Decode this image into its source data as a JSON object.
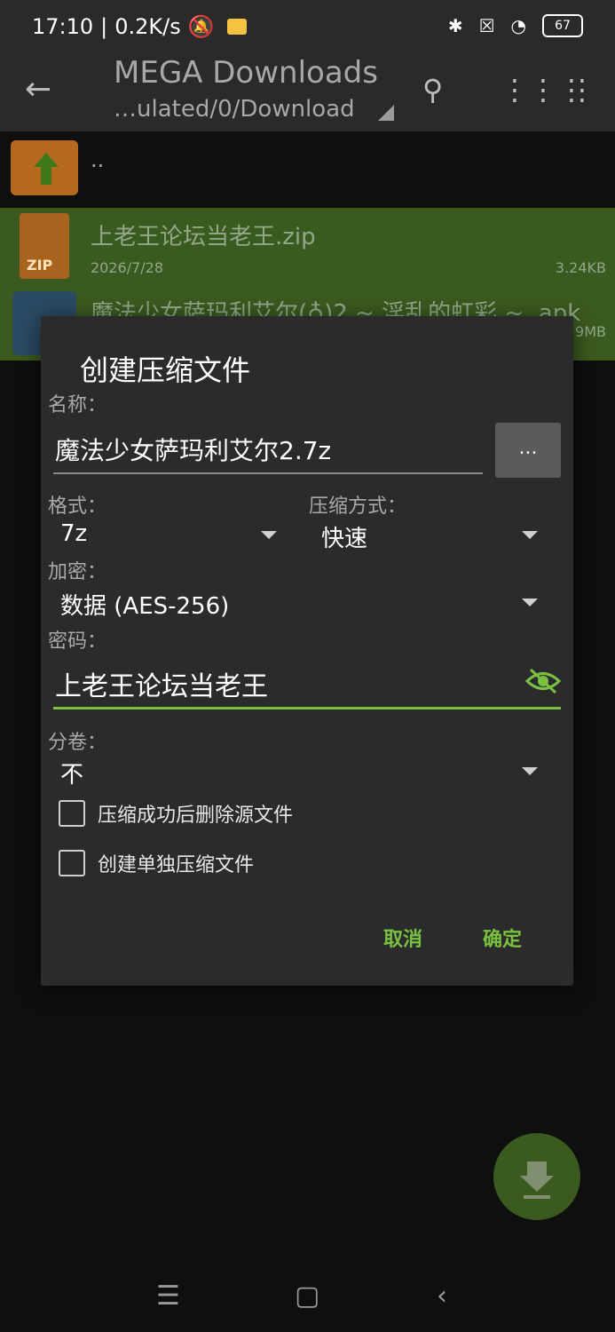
{
  "status_bar": {
    "time": "17:10",
    "separator": "|",
    "speed": "0.2K/s",
    "battery": "67"
  },
  "app_bar": {
    "title": "MEGA Downloads",
    "subtitle": "…ulated/0/Download"
  },
  "file_list": {
    "up_label": "..",
    "items": [
      {
        "name": "上老王论坛当老王.zip",
        "date": "2026/7/28",
        "size": "3.24KB",
        "icon_label": "ZIP"
      },
      {
        "name": "魔法少女萨玛利艾尔(♁)2 ~ 淫乱的虹彩 ~ .apk",
        "date": "",
        "size": "9MB"
      }
    ]
  },
  "dialog": {
    "title": "创建压缩文件",
    "name_label": "名称：",
    "name_value": "魔法少女萨玛利艾尔2.7z",
    "browse_label": "...",
    "format_label": "格式：",
    "format_value": "7z",
    "method_label": "压缩方式：",
    "method_value": "快速",
    "encryption_label": "加密：",
    "encryption_value": "数据 (AES-256)",
    "password_label": "密码：",
    "password_value": "上老王论坛当老王",
    "split_label": "分卷：",
    "split_value": "不",
    "checkbox_delete": "压缩成功后删除源文件",
    "checkbox_separate": "创建单独压缩文件",
    "cancel": "取消",
    "ok": "确定"
  },
  "colors": {
    "accent": "#7ac142",
    "selection": "#3b5a1f",
    "dialog_bg": "#2b2b2b"
  }
}
